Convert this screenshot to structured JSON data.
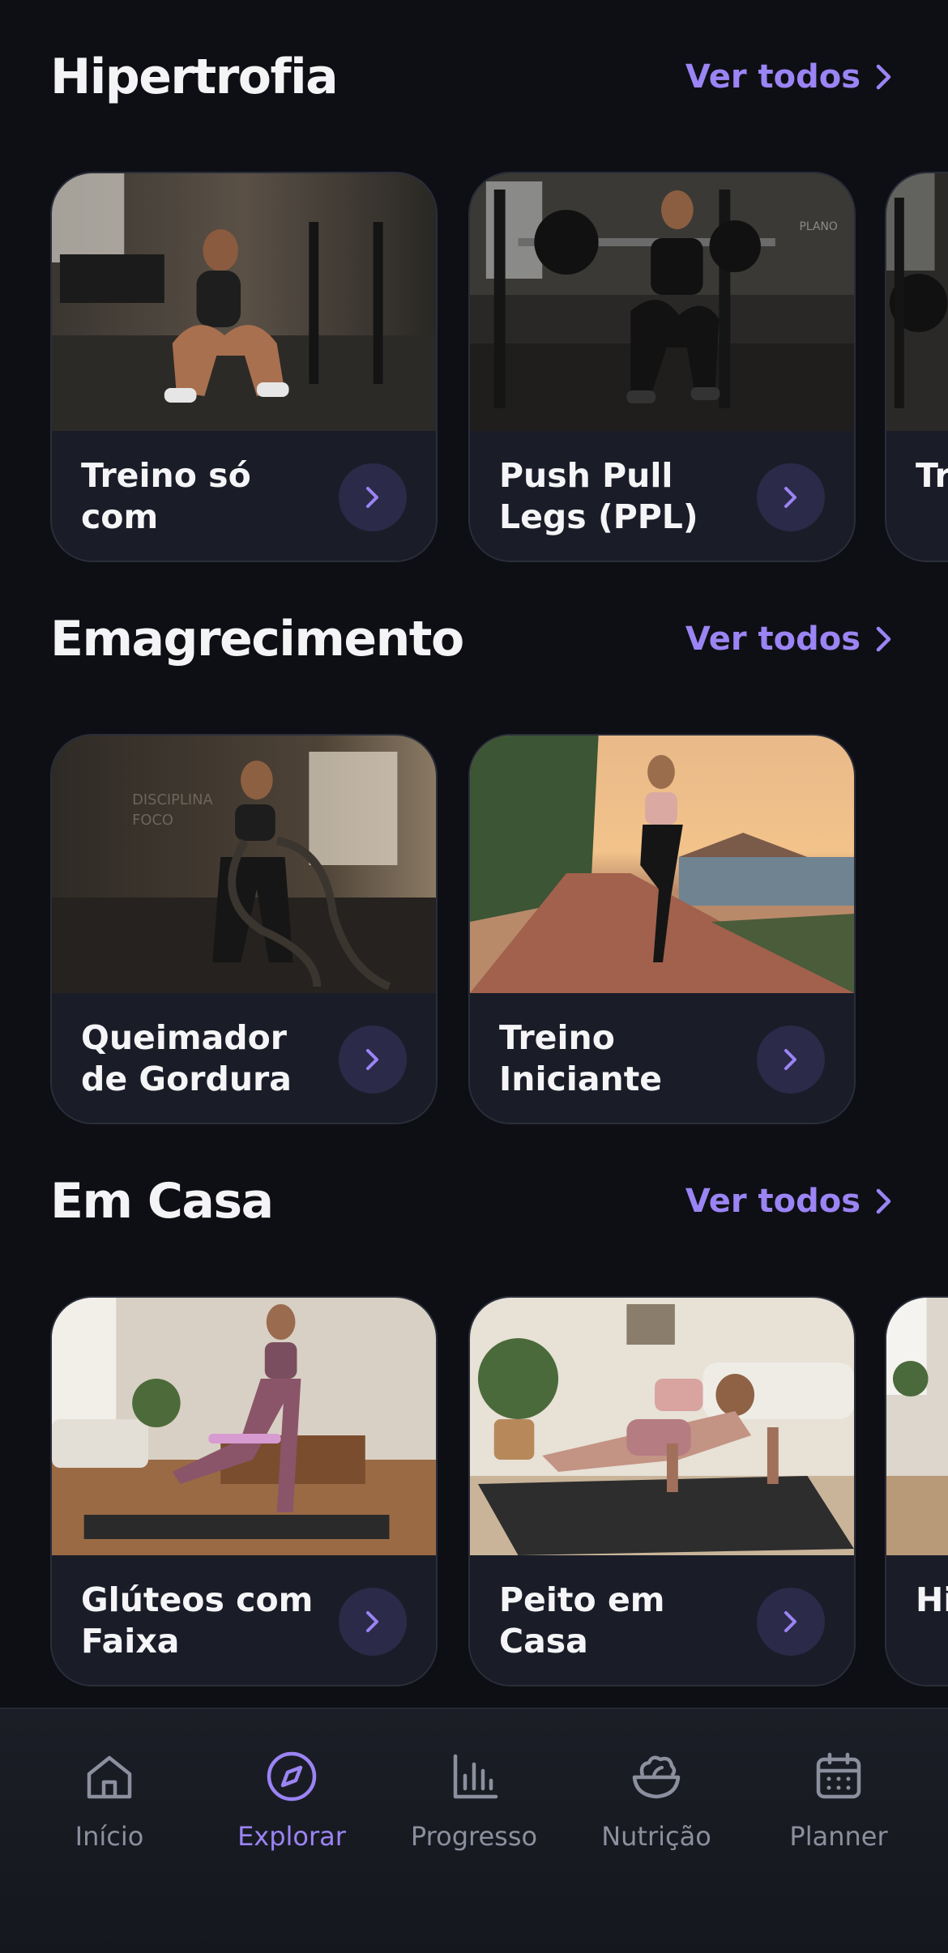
{
  "sections": [
    {
      "title": "Hipertrofia",
      "see_all": "Ver todos",
      "cards": [
        {
          "title": "Treino só com Halteres",
          "image": "woman-goblet-squat-dumbbell-gym"
        },
        {
          "title": "Push Pull Legs (PPL)",
          "image": "man-barbell-squat-gym"
        },
        {
          "title": "Tr… Ga…",
          "image": "gym-barbell-rack"
        }
      ]
    },
    {
      "title": "Emagrecimento",
      "see_all": "Ver todos",
      "cards": [
        {
          "title": "Queimador de Gordura",
          "image": "woman-battle-ropes-gym"
        },
        {
          "title": "Treino Iniciante de...",
          "image": "woman-running-seaside-sunset"
        }
      ]
    },
    {
      "title": "Em Casa",
      "see_all": "Ver todos",
      "cards": [
        {
          "title": "Glúteos com Faixa",
          "image": "woman-resistance-band-living-room"
        },
        {
          "title": "Peito em Casa",
          "image": "woman-pushup-living-room"
        },
        {
          "title": "Hi… In…",
          "image": "home-interior"
        }
      ]
    }
  ],
  "nav": {
    "items": [
      {
        "label": "Início",
        "icon": "home-icon",
        "active": false
      },
      {
        "label": "Explorar",
        "icon": "compass-icon",
        "active": true
      },
      {
        "label": "Progresso",
        "icon": "bar-chart-icon",
        "active": false
      },
      {
        "label": "Nutrição",
        "icon": "salad-bowl-icon",
        "active": false
      },
      {
        "label": "Planner",
        "icon": "calendar-icon",
        "active": false
      }
    ]
  },
  "colors": {
    "background": "#0e0f14",
    "card": "#1a1d28",
    "accent": "#9b84f4",
    "arrow_bg": "#2b2a48",
    "nav_inactive": "#8c8f9d"
  }
}
